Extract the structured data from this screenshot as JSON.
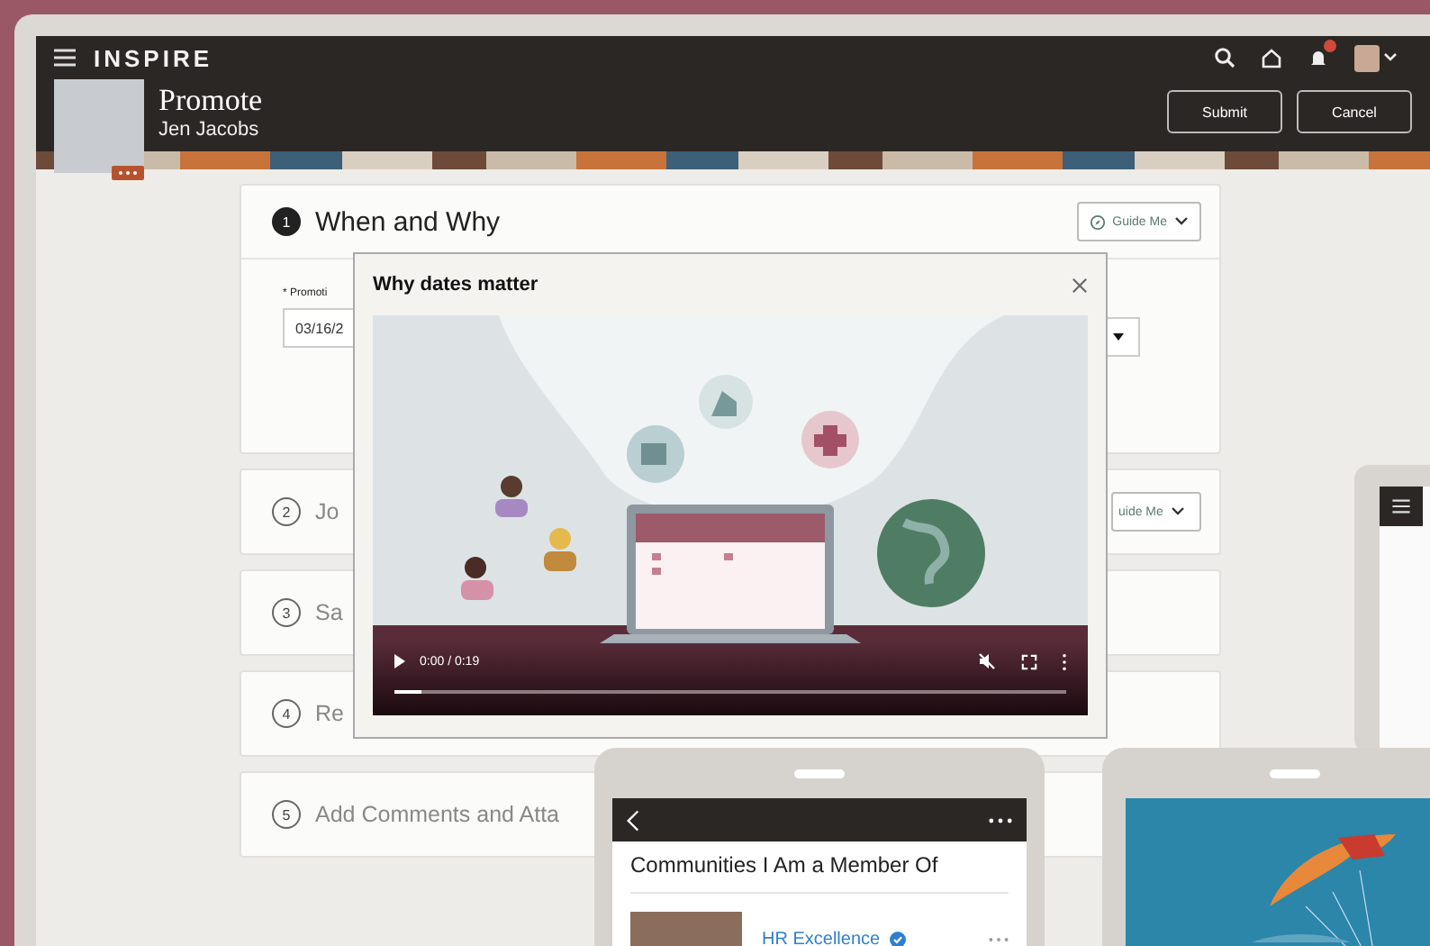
{
  "app": {
    "logo": "INSPIRE",
    "notifications": true
  },
  "header": {
    "title": "Promote",
    "subtitle": "Jen Jacobs",
    "actions": [
      "Submit",
      "Cancel"
    ]
  },
  "steps": [
    {
      "number": "1",
      "title": "When and Why",
      "expanded": true,
      "guide": "Guide Me"
    },
    {
      "number": "2",
      "title": "Jo",
      "expanded": false,
      "guide": "uide Me"
    },
    {
      "number": "3",
      "title": "Sa",
      "expanded": false
    },
    {
      "number": "4",
      "title": "Re",
      "expanded": false
    },
    {
      "number": "5",
      "title": "Add Comments and Atta",
      "expanded": false
    }
  ],
  "form": {
    "label": "* Promoti",
    "date_value": "03/16/2"
  },
  "dialog": {
    "title": "Why dates matter",
    "video": {
      "time": "0:00 / 0:19",
      "level": 0.04
    }
  },
  "phone": {
    "title": "Communities I Am a Member Of",
    "item": {
      "name": "HR Excellence",
      "verified": true
    }
  }
}
